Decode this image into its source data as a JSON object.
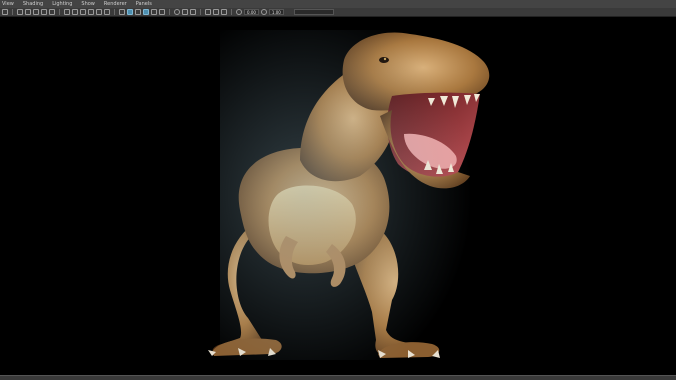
{
  "menu": [
    "View",
    "Shading",
    "Lighting",
    "Show",
    "Renderer",
    "Panels"
  ],
  "toolbar": {
    "field_a": "0.00",
    "field_b": "1.00"
  },
  "colors": {
    "menubar_bg": "#444444",
    "toolbar_bg": "#3a3a3a",
    "viewport_bg": "#000000",
    "highlight": "#4d8fb0"
  }
}
